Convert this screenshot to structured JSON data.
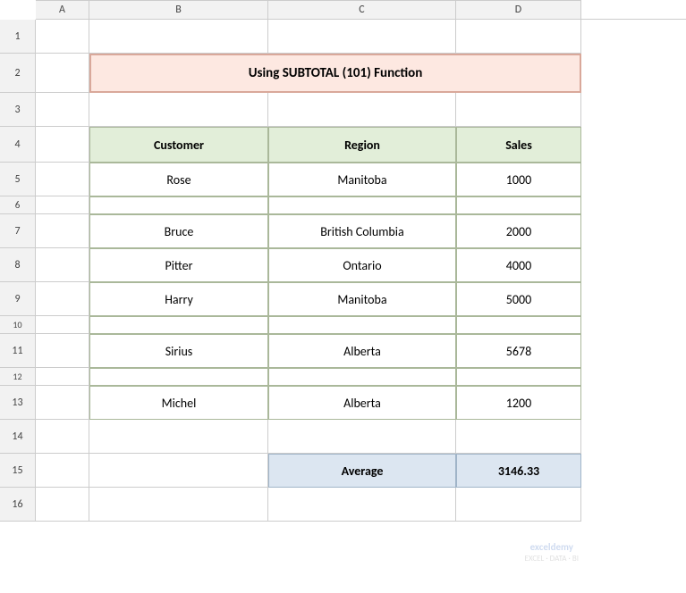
{
  "title": "Using SUBTOTAL (101)  Function",
  "columns": {
    "a": "A",
    "b": "B",
    "c": "C",
    "d": "D"
  },
  "row_numbers": [
    "1",
    "2",
    "3",
    "4",
    "5",
    "6",
    "7",
    "8",
    "9",
    "10",
    "11",
    "12",
    "13",
    "14",
    "15",
    "16"
  ],
  "headers": {
    "customer": "Customer",
    "region": "Region",
    "sales": "Sales"
  },
  "rows": [
    {
      "customer": "Rose",
      "region": "Manitoba",
      "sales": "1000"
    },
    {
      "customer": "",
      "region": "",
      "sales": ""
    },
    {
      "customer": "Bruce",
      "region": "British Columbia",
      "sales": "2000"
    },
    {
      "customer": "Pitter",
      "region": "Ontario",
      "sales": "4000"
    },
    {
      "customer": "Harry",
      "region": "Manitoba",
      "sales": "5000"
    },
    {
      "customer": "",
      "region": "",
      "sales": ""
    },
    {
      "customer": "Sirius",
      "region": "Alberta",
      "sales": "5678"
    },
    {
      "customer": "",
      "region": "",
      "sales": ""
    },
    {
      "customer": "Michel",
      "region": "Alberta",
      "sales": "1200"
    }
  ],
  "average": {
    "label": "Average",
    "value": "3146.33"
  },
  "watermark": {
    "line1": "exceldemy",
    "line2": "EXCEL · DATA · BI"
  }
}
